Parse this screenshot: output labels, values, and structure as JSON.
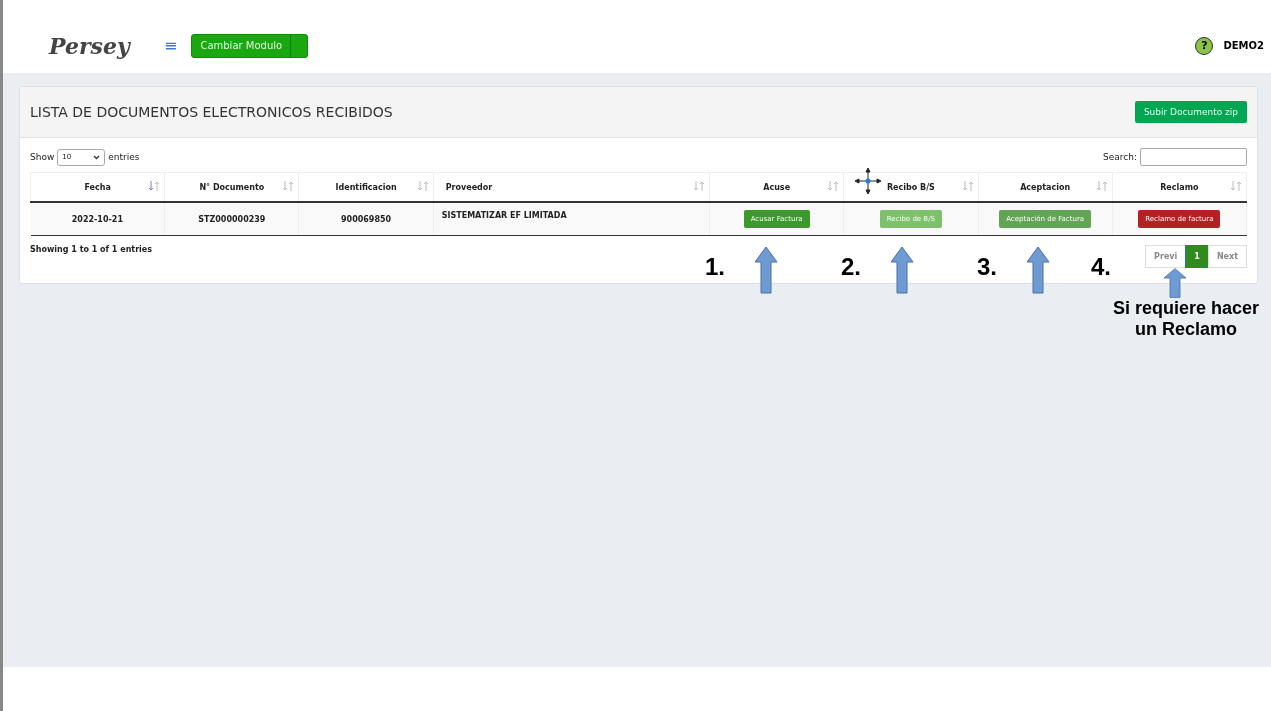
{
  "header": {
    "logo": "Persey",
    "menu_icon": "≡",
    "help_icon": "?",
    "module_button": "Cambiar Modulo",
    "user": "DEMO2"
  },
  "card": {
    "title": "LISTA DE DOCUMENTOS ELECTRONICOS RECIBIDOS",
    "upload_button": "Subir Documento zip"
  },
  "table_controls": {
    "show_label": "Show",
    "page_size": "10",
    "entries_label": "entries",
    "search_label": "Search:"
  },
  "table": {
    "columns": [
      {
        "label": "Fecha",
        "sorted": true
      },
      {
        "label": "N° Documento",
        "sorted": false
      },
      {
        "label": "Identificacion",
        "sorted": false
      },
      {
        "label": "Proveedor",
        "sorted": false
      },
      {
        "label": "Acuse",
        "sorted": false
      },
      {
        "label": "Recibo B/S",
        "sorted": false
      },
      {
        "label": "Aceptacion",
        "sorted": false
      },
      {
        "label": "Reclamo",
        "sorted": false
      }
    ],
    "rows": [
      {
        "cells": [
          "2022-10-21",
          "STZ000000239",
          "900069850",
          "SISTEMATIZAR EF LIMITADA"
        ],
        "actions": [
          {
            "label": "Acusar Factura",
            "color": "#3c9a2c"
          },
          {
            "label": "Recibo de B/S",
            "color": "#7dc16a"
          },
          {
            "label": "Aceptación de Factura",
            "color": "#62a655"
          },
          {
            "label": "Reclamo de factura",
            "color": "#b22222"
          }
        ]
      }
    ]
  },
  "footer": {
    "info": "Showing 1 to 1 of 1 entries",
    "pagination": [
      {
        "label": "Previ",
        "selected": false
      },
      {
        "label": "1",
        "selected": true
      },
      {
        "label": "Next",
        "selected": false
      }
    ]
  },
  "annotations": [
    {
      "number": "1."
    },
    {
      "number": "2."
    },
    {
      "number": "3."
    },
    {
      "number": "4.",
      "note": "Si requiere hacer un Reclamo"
    }
  ]
}
